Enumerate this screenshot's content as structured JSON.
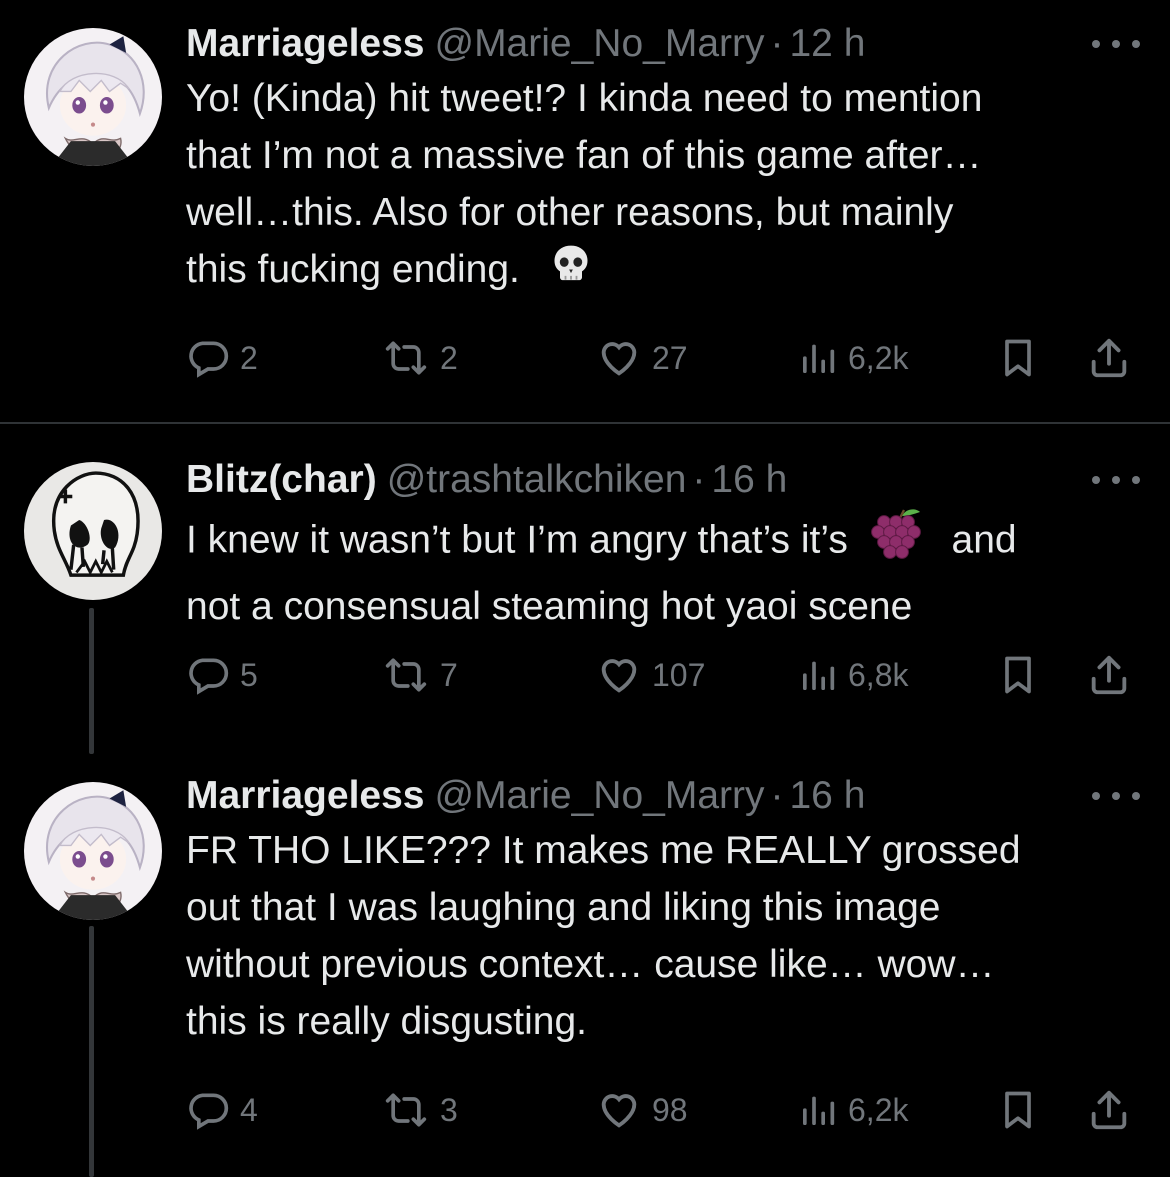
{
  "tweets": [
    {
      "name": "Marriageless",
      "handle": "@Marie_No_Marry",
      "dot": "·",
      "time": "12 h",
      "lines": [
        "Yo! (Kinda) hit tweet!? I kinda need to mention",
        "that I’m not a massive fan of this game after…",
        "well…this. Also for other reasons, but mainly",
        "this fucking ending."
      ],
      "emoji": "skull-emoji",
      "replies": "2",
      "retweets": "2",
      "likes": "27",
      "views": "6,2k"
    },
    {
      "name": "Blitz(char)",
      "handle": "@trashtalkchiken",
      "dot": "·",
      "time": "16 h",
      "lines": [
        "I knew it wasn’t but I’m angry that’s it’s",
        "and",
        "not a consensual steaming hot yaoi scene"
      ],
      "emoji": "grapes-emoji",
      "replies": "5",
      "retweets": "7",
      "likes": "107",
      "views": "6,8k"
    },
    {
      "name": "Marriageless",
      "handle": "@Marie_No_Marry",
      "dot": "·",
      "time": "16 h",
      "lines": [
        "FR THO LIKE??? It makes me REALLY grossed",
        "out that I was laughing and liking this image",
        "without previous context… cause like… wow…",
        "this is really disgusting."
      ],
      "replies": "4",
      "retweets": "3",
      "likes": "98",
      "views": "6,2k"
    }
  ],
  "icons": {
    "reply": "reply-icon",
    "retweet": "retweet-icon",
    "like": "heart-icon",
    "views": "views-icon",
    "bookmark": "bookmark-icon",
    "share": "share-icon",
    "more": "more-icon"
  },
  "colors": {
    "background": "#000000",
    "text": "#e7e9ea",
    "muted": "#71767b",
    "divider": "#2f3336"
  }
}
